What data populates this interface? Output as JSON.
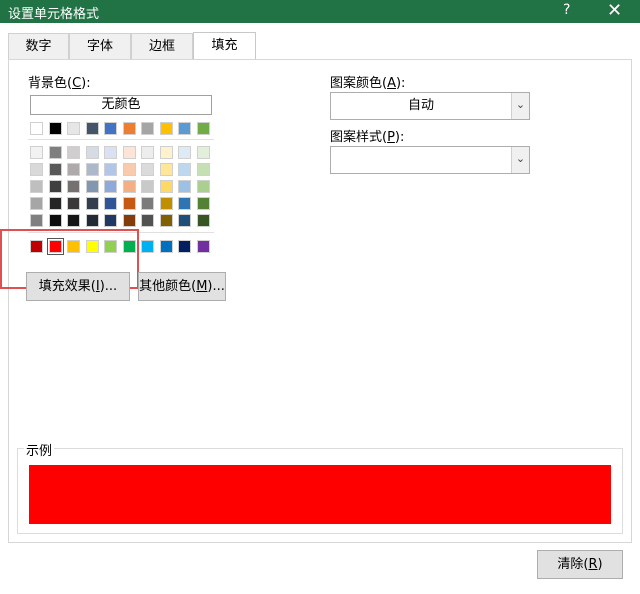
{
  "window": {
    "title": "设置单元格格式",
    "help": "?",
    "close": "✕"
  },
  "tabs": [
    "数字",
    "字体",
    "边框",
    "填充"
  ],
  "fill": {
    "background_label": "背景色(",
    "background_key": "C",
    "background_suffix": "):",
    "no_color": "无颜色",
    "fill_effects_prefix": "填充效果(",
    "fill_effects_key": "I",
    "fill_effects_suffix": ")...",
    "more_colors_prefix": "其他颜色(",
    "more_colors_key": "M",
    "more_colors_suffix": ")...",
    "pattern_color_label": "图案颜色(",
    "pattern_color_key": "A",
    "pattern_color_suffix": "):",
    "pattern_color_value": "自动",
    "pattern_style_label": "图案样式(",
    "pattern_style_key": "P",
    "pattern_style_suffix": "):",
    "pattern_style_value": ""
  },
  "palette": {
    "theme_row": [
      "#FFFFFF",
      "#000000",
      "#E7E6E6",
      "#44546A",
      "#4472C4",
      "#ED7D31",
      "#A5A5A5",
      "#FFC000",
      "#5B9BD5",
      "#70AD47"
    ],
    "tint_rows": [
      [
        "#F2F2F2",
        "#7F7F7F",
        "#D0CECE",
        "#D6DCE4",
        "#D9E1F2",
        "#FCE4D6",
        "#EDEDED",
        "#FFF2CC",
        "#DDEBF7",
        "#E2EFDA"
      ],
      [
        "#D9D9D9",
        "#595959",
        "#AEAAAA",
        "#ACB9CA",
        "#B4C6E7",
        "#F8CBAD",
        "#DBDBDB",
        "#FFE699",
        "#BDD7EE",
        "#C6E0B4"
      ],
      [
        "#BFBFBF",
        "#3F3F3F",
        "#757171",
        "#8497B0",
        "#8EA9DB",
        "#F4B084",
        "#C9C9C9",
        "#FFD966",
        "#9BC2E6",
        "#A9D08E"
      ],
      [
        "#A6A6A6",
        "#262626",
        "#3A3838",
        "#333F4F",
        "#2F5597",
        "#C65911",
        "#7B7B7B",
        "#BF8F00",
        "#2E75B6",
        "#548235"
      ],
      [
        "#808080",
        "#0D0D0D",
        "#171616",
        "#222B35",
        "#1F3864",
        "#833C0C",
        "#525252",
        "#806000",
        "#1F4E78",
        "#375623"
      ]
    ],
    "standard_row": [
      "#C00000",
      "#FF0000",
      "#FFC000",
      "#FFFF00",
      "#92D050",
      "#00B050",
      "#00B0F0",
      "#0070C0",
      "#002060",
      "#7030A0"
    ],
    "selected_standard_index": 1
  },
  "preview": {
    "label": "示例",
    "color": "#FF0000"
  },
  "footer": {
    "clear_prefix": "清除(",
    "clear_key": "R",
    "clear_suffix": ")"
  },
  "accent": "#217346"
}
